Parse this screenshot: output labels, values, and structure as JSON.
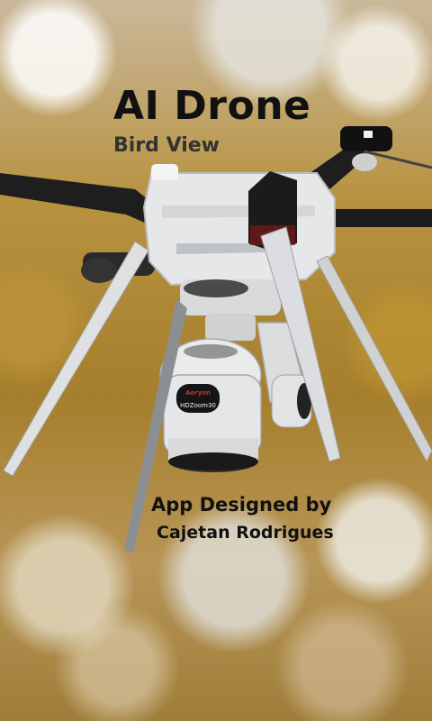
{
  "splash": {
    "title": "AI Drone",
    "subtitle": "Bird View",
    "credit_line1": "App Designed by",
    "credit_line2": "Cajetan Rodrigues"
  },
  "drone": {
    "camera_brand": "Aeryon",
    "camera_model": "HDZoom30",
    "body_color": "#e6e7e8",
    "arm_color": "#1c1c1c"
  },
  "background": {
    "theme_colors": [
      "#b8923f",
      "#a67f2c",
      "#e8e8e4"
    ]
  }
}
